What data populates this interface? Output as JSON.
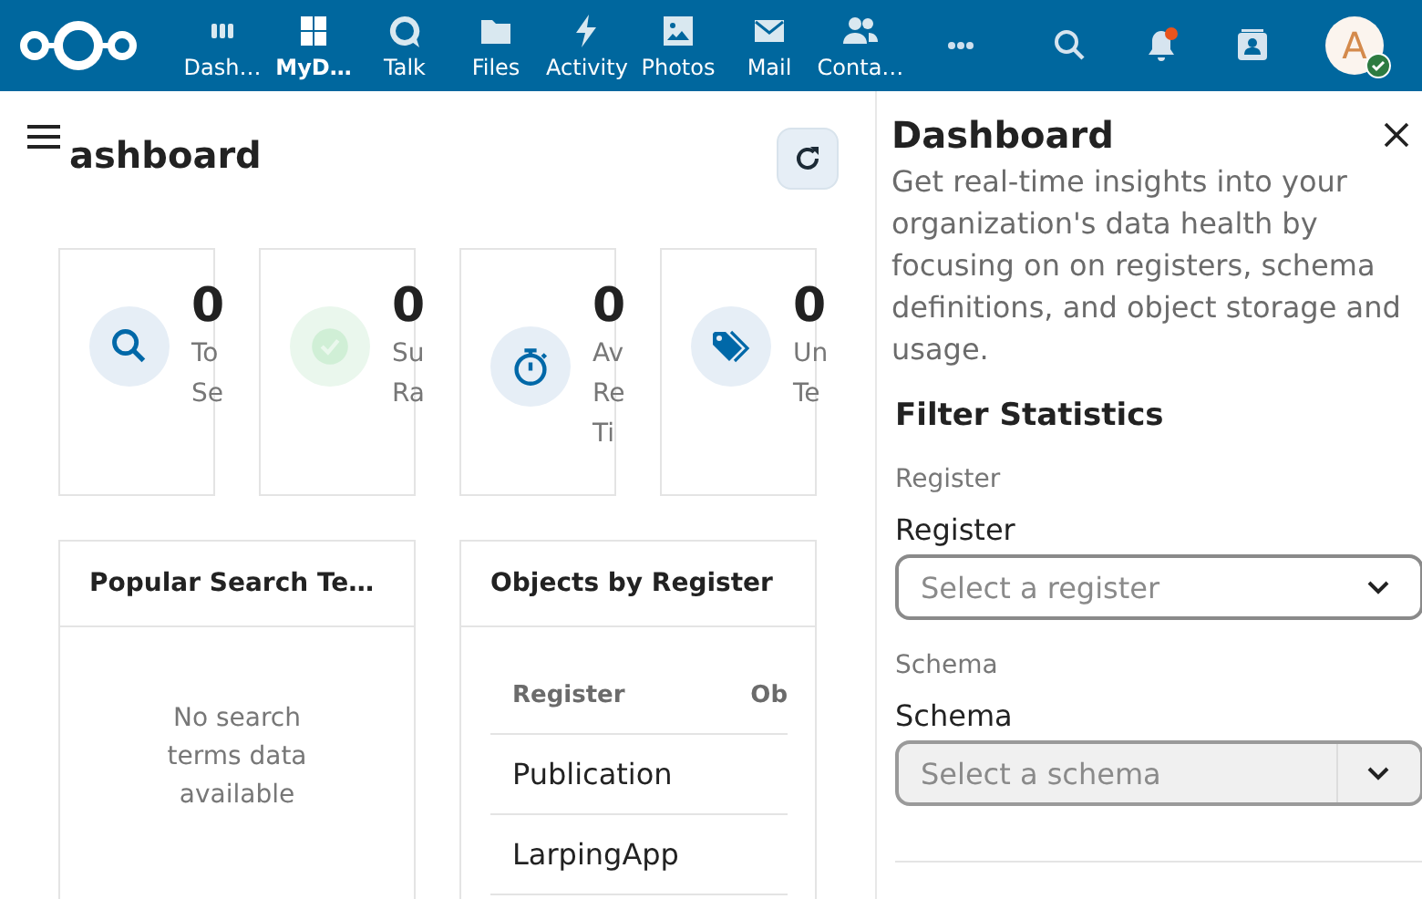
{
  "header": {
    "apps": [
      {
        "label": "Dash…",
        "kind": "dashboard",
        "selected": false
      },
      {
        "label": "MyD…",
        "kind": "grid",
        "selected": true
      },
      {
        "label": "Talk",
        "kind": "talk",
        "selected": false
      },
      {
        "label": "Files",
        "kind": "folder",
        "selected": false
      },
      {
        "label": "Activity",
        "kind": "bolt",
        "selected": false
      },
      {
        "label": "Photos",
        "kind": "image",
        "selected": false
      },
      {
        "label": "Mail",
        "kind": "mail",
        "selected": false
      },
      {
        "label": "Conta…",
        "kind": "people",
        "selected": false
      }
    ],
    "notifications_unread": true,
    "avatar": {
      "initial": "A",
      "online": true
    }
  },
  "page": {
    "title": "ashboard",
    "stat_cards": [
      {
        "kind": "search",
        "value": "0",
        "label": "To Se"
      },
      {
        "kind": "success",
        "value": "0",
        "label": "Su Ra"
      },
      {
        "kind": "timer",
        "value": "0",
        "label": "Av Re Ti"
      },
      {
        "kind": "tag",
        "value": "0",
        "label": "Un Te"
      }
    ],
    "popular_panel": {
      "title": "Popular Search Te…",
      "empty_text": "No search terms data available"
    },
    "objects_panel": {
      "title": "Objects by Register",
      "columns": [
        "Register",
        "Ob"
      ],
      "rows": [
        [
          "Publication"
        ],
        [
          "LarpingApp"
        ]
      ]
    }
  },
  "sidebar": {
    "title": "Dashboard",
    "description": "Get real-time insights into your organization's data health by focusing on on registers, schema definitions, and object storage and usage.",
    "filter_title": "Filter Statistics",
    "filters": [
      {
        "section": "Register",
        "label": "Register",
        "placeholder": "Select a register",
        "disabled": false
      },
      {
        "section": "Schema",
        "label": "Schema",
        "placeholder": "Select a schema",
        "disabled": true
      }
    ]
  }
}
